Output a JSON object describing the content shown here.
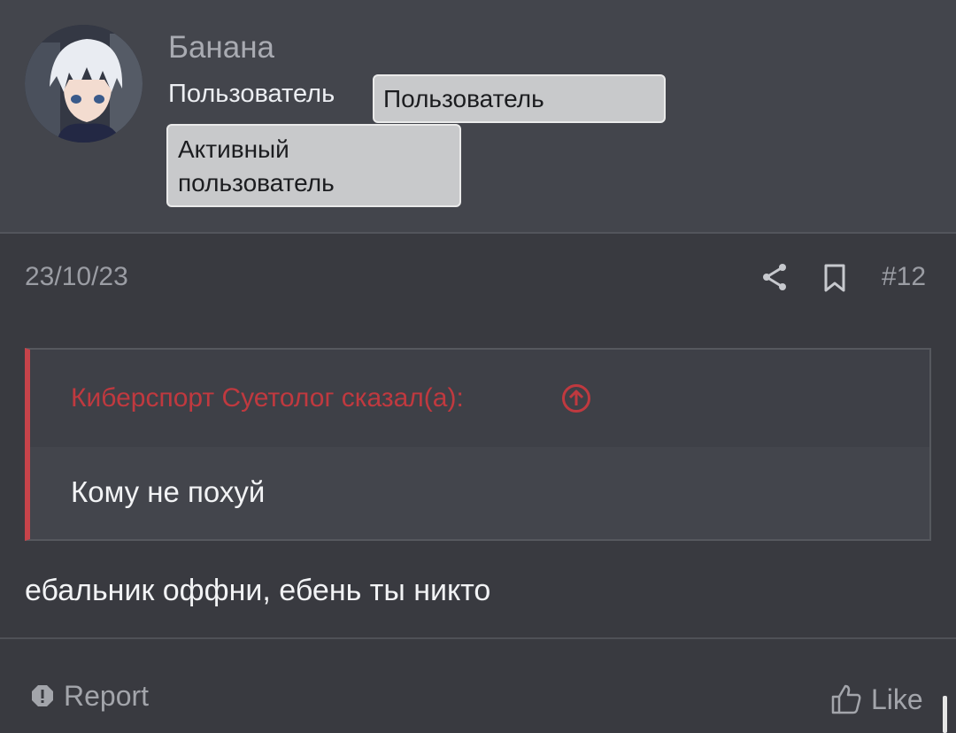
{
  "user": {
    "name": "Банана",
    "role_text": "Пользователь",
    "badge_role": "Пользователь",
    "badge_status_line1": "Активный",
    "badge_status_line2": "пользователь"
  },
  "post": {
    "date": "23/10/23",
    "number": "#12",
    "message": "ебальник оффни, ебень ты никто"
  },
  "quote": {
    "author": "Киберспорт Суетолог сказал(а):",
    "text": "Кому не похуй"
  },
  "actions": {
    "report_label": "Report",
    "like_label": "Like"
  },
  "icons": {
    "share": "share-icon",
    "bookmark": "bookmark-icon",
    "quote_jump": "arrow-up-circle-icon",
    "report": "report-icon",
    "like": "thumbs-up-icon"
  },
  "colors": {
    "background": "#393a40",
    "header_background": "#43454c",
    "quote_accent": "#c7434a",
    "badge_background": "#c8c9cb"
  }
}
